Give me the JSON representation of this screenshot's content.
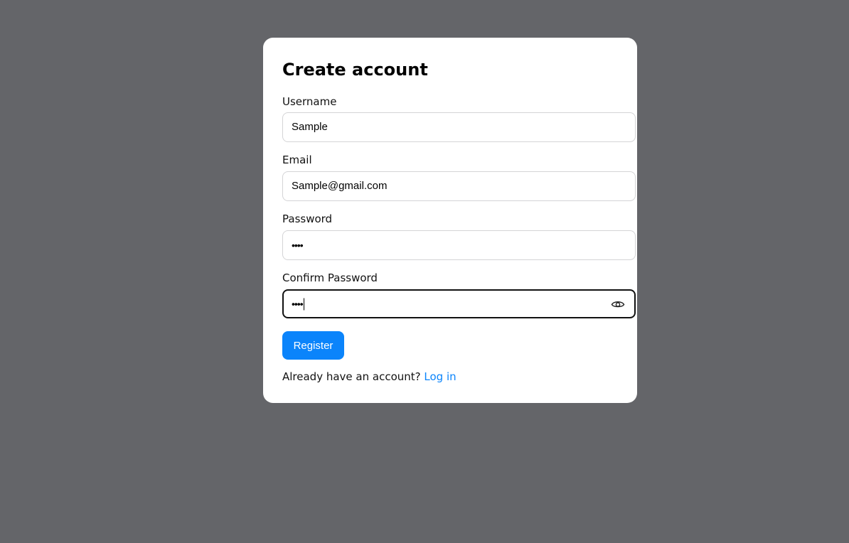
{
  "form": {
    "title": "Create account",
    "fields": {
      "username": {
        "label": "Username",
        "value": "Sample"
      },
      "email": {
        "label": "Email",
        "value": "Sample@gmail.com"
      },
      "password": {
        "label": "Password",
        "value": "••••"
      },
      "confirm_password": {
        "label": "Confirm Password",
        "value": "••••",
        "toggle_icon": "eye-icon"
      }
    },
    "register_label": "Register",
    "footer_text": "Already have an account?",
    "login_link": "Log in"
  },
  "colors": {
    "background": "#646569",
    "card": "#ffffff",
    "accent": "#0b84fb",
    "focus_border": "#111111"
  }
}
